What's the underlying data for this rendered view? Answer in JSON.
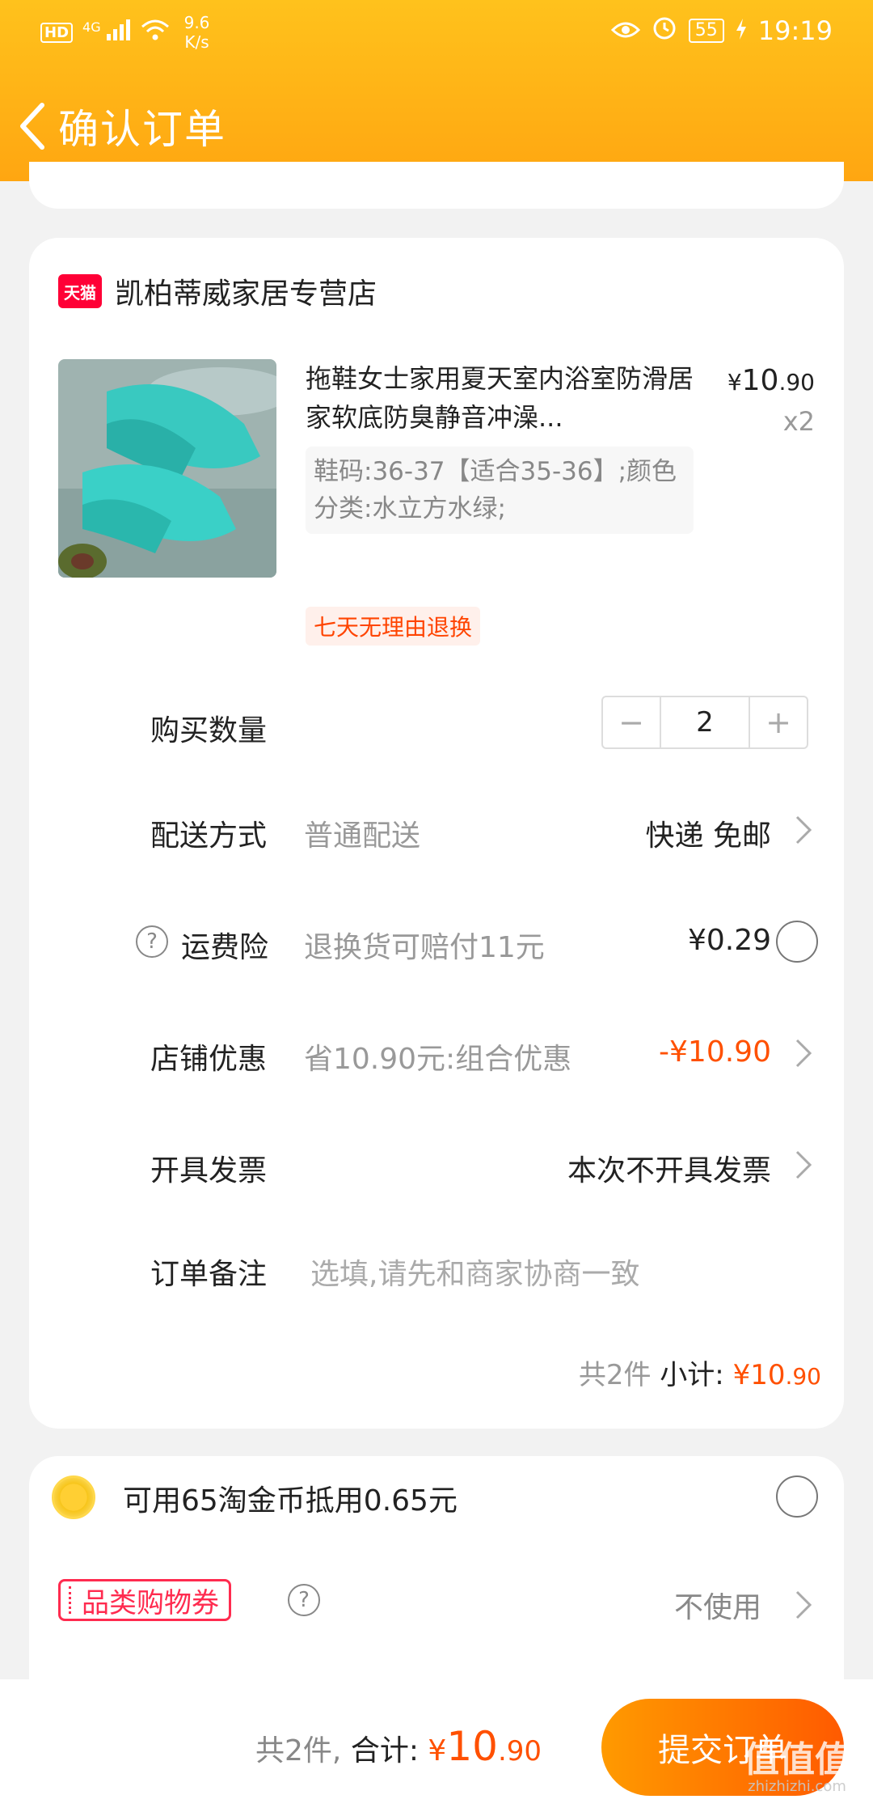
{
  "status_bar": {
    "network": "HD",
    "signal": "4G",
    "speed_value": "9.6",
    "speed_unit": "K/s",
    "battery": "55",
    "time": "19:19"
  },
  "nav": {
    "title": "确认订单"
  },
  "shop": {
    "badge": "天猫",
    "name": "凯柏蒂威家居专营店"
  },
  "product": {
    "title": "拖鞋女士家用夏天室内浴室防滑居家软底防臭静音冲澡...",
    "sku": "鞋码:36-37【适合35-36】;颜色分类:水立方水绿;",
    "price_symbol": "¥",
    "price_int": "10",
    "price_dec": ".90",
    "quantity_label": "x2",
    "return_tag": "七天无理由退换"
  },
  "rows": {
    "quantity": {
      "label": "购买数量",
      "minus": "−",
      "value": "2",
      "plus": "+"
    },
    "delivery": {
      "label": "配送方式",
      "sub": "普通配送",
      "value": "快递 免邮"
    },
    "insurance": {
      "label": "运费险",
      "help": "?",
      "sub": "退换货可赔付11元",
      "value": "¥0.29"
    },
    "discount": {
      "label": "店铺优惠",
      "sub": "省10.90元:组合优惠",
      "value": "-¥10.90"
    },
    "invoice": {
      "label": "开具发票",
      "value": "本次不开具发票"
    },
    "note": {
      "label": "订单备注",
      "placeholder": "选填,请先和商家协商一致"
    }
  },
  "subtotal": {
    "count": "共2件",
    "label": "小计:",
    "symbol": "¥",
    "int": "10",
    "dec": ".90"
  },
  "coins": {
    "text": "可用65淘金币抵用0.65元"
  },
  "coupon": {
    "label": "品类购物券",
    "help": "?",
    "value": "不使用"
  },
  "bottom": {
    "count": "共2件,",
    "label": "合计:",
    "symbol": "¥",
    "int": "10",
    "dec": ".90",
    "submit": "提交订单"
  },
  "watermark": {
    "main": "值值值",
    "site": "zhizhizhi.com"
  },
  "colors": {
    "accent": "#ff5000",
    "header": "#ffad14",
    "tmall": "#ff0036"
  }
}
